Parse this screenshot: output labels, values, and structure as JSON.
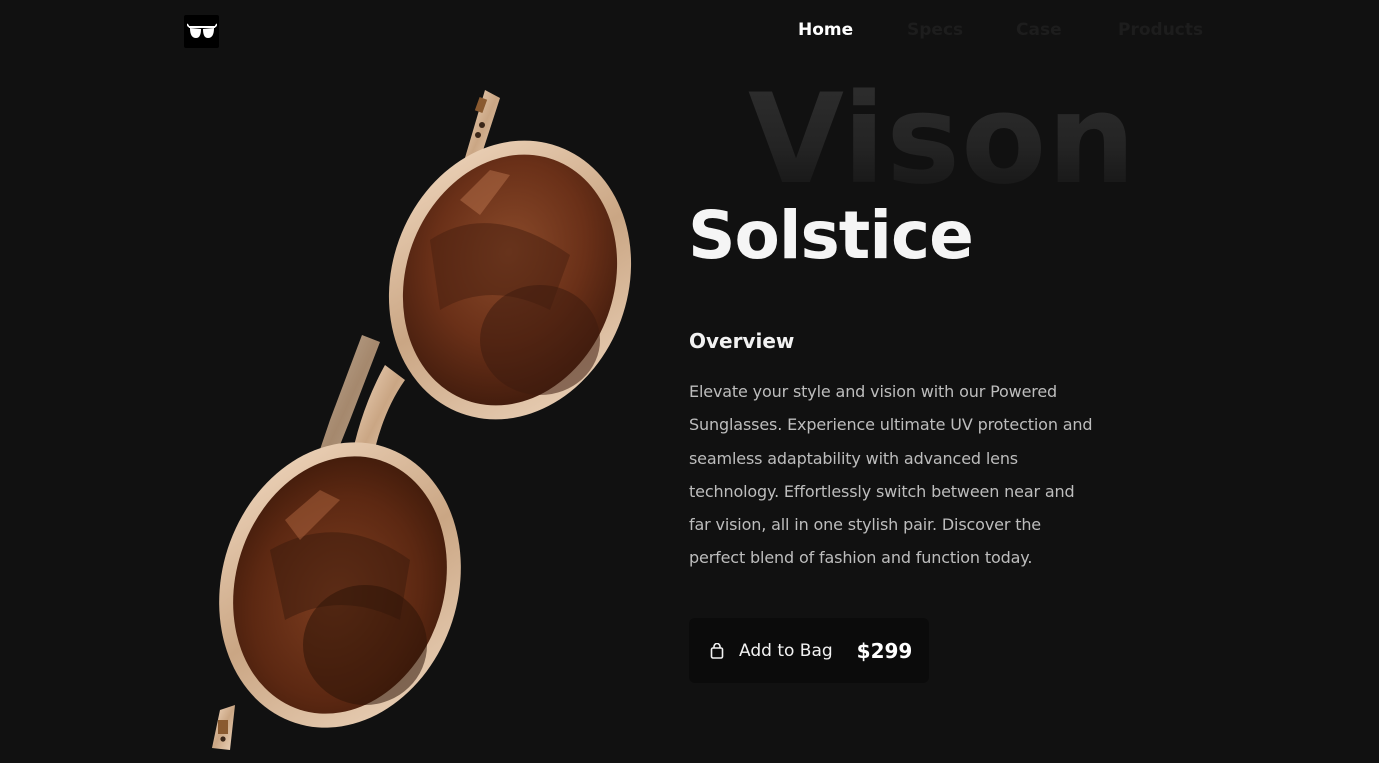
{
  "header": {
    "logo_icon": "sunglasses-icon",
    "nav": [
      {
        "label": "Home",
        "active": true
      },
      {
        "label": "Specs",
        "active": false
      },
      {
        "label": "Case",
        "active": false
      },
      {
        "label": "Products",
        "active": false
      }
    ]
  },
  "hero": {
    "background_word": "Vison",
    "product_name": "Solstice",
    "product_image": "tortoise-round-sunglasses",
    "overview_title": "Overview",
    "overview_text": "Elevate your style and vision with our Powered Sunglasses. Experience ultimate UV protection and seamless adaptability with advanced lens technology. Effortlessly switch between near and far vision, all in one stylish pair. Discover the perfect blend of fashion and function today."
  },
  "cart": {
    "icon": "shopping-bag-icon",
    "label": "Add to Bag",
    "price": "$299"
  },
  "colors": {
    "background": "#111111",
    "lens": "#7a3a1c",
    "frame": "#e8cdb4",
    "button_bg": "#0b0b0b"
  }
}
